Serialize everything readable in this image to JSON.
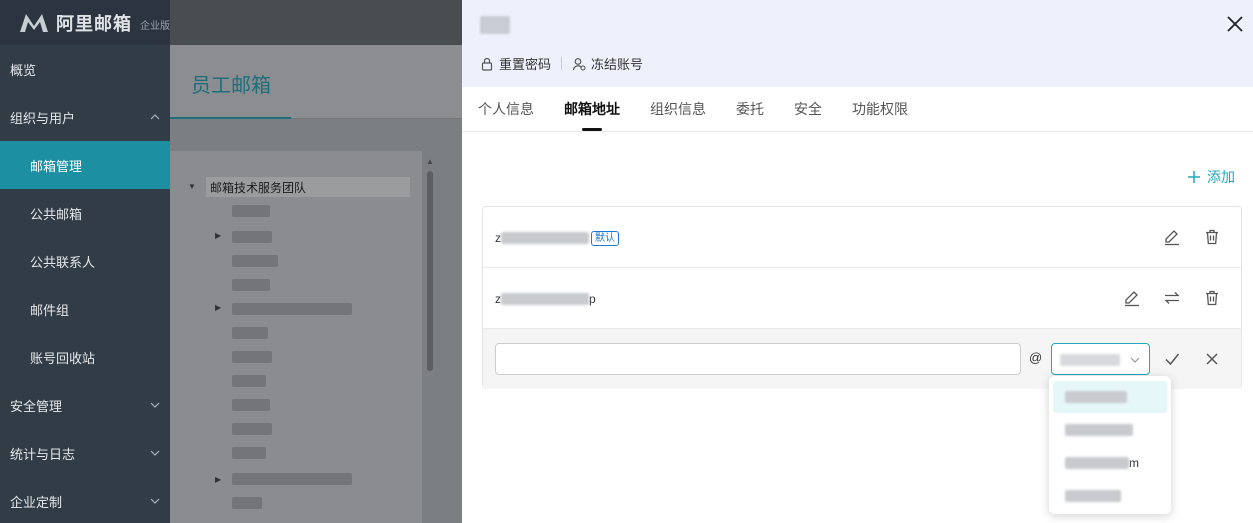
{
  "brand": {
    "name": "阿里邮箱",
    "edition": "企业版"
  },
  "sidebar": {
    "items": [
      {
        "label": "概览",
        "type": "top",
        "chevron": ""
      },
      {
        "label": "组织与用户",
        "type": "top",
        "chevron": "up"
      },
      {
        "label": "邮箱管理",
        "type": "sub",
        "chevron": "",
        "active": true
      },
      {
        "label": "公共邮箱",
        "type": "sub",
        "chevron": ""
      },
      {
        "label": "公共联系人",
        "type": "sub",
        "chevron": ""
      },
      {
        "label": "邮件组",
        "type": "sub",
        "chevron": ""
      },
      {
        "label": "账号回收站",
        "type": "sub",
        "chevron": ""
      },
      {
        "label": "安全管理",
        "type": "top",
        "chevron": "down"
      },
      {
        "label": "统计与日志",
        "type": "top",
        "chevron": "down"
      },
      {
        "label": "企业定制",
        "type": "top",
        "chevron": "down"
      }
    ]
  },
  "main": {
    "title": "员工邮箱",
    "tree_root": "邮箱技术服务团队"
  },
  "drawer": {
    "actions": {
      "reset_password": "重置密码",
      "freeze_account": "冻结账号"
    },
    "tabs": [
      {
        "label": "个人信息",
        "active": false
      },
      {
        "label": "邮箱地址",
        "active": true
      },
      {
        "label": "组织信息",
        "active": false
      },
      {
        "label": "委托",
        "active": false
      },
      {
        "label": "安全",
        "active": false
      },
      {
        "label": "功能权限",
        "active": false
      }
    ],
    "add_label": "添加",
    "addresses": [
      {
        "lead": "z",
        "trail": "",
        "default_badge": "默认"
      },
      {
        "lead": "z",
        "trail": "p",
        "default_badge": ""
      }
    ],
    "edit": {
      "input_value": "",
      "at_sign": "@"
    },
    "dropdown": {
      "options": [
        {
          "tail": "",
          "selected": true
        },
        {
          "tail": "",
          "selected": false
        },
        {
          "tail": "m",
          "selected": false
        },
        {
          "tail": "",
          "selected": false
        }
      ]
    }
  },
  "colors": {
    "accent": "#1fa8bf",
    "sidebar_bg": "#323c47",
    "active_nav": "#1d8fa3",
    "badge": "#1a7ad6"
  }
}
